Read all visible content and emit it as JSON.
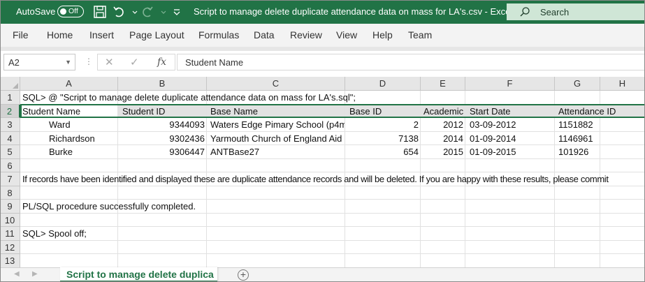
{
  "titlebar": {
    "autosave_label": "AutoSave",
    "autosave_state": "Off",
    "doc_title": "Script to manage delete duplicate attendance data on mass for LA's.csv  -  Excel",
    "search_placeholder": "Search",
    "accent_color": "#217346"
  },
  "menu": [
    "File",
    "Home",
    "Insert",
    "Page Layout",
    "Formulas",
    "Data",
    "Review",
    "View",
    "Help",
    "Team"
  ],
  "formula_bar": {
    "name_box": "A2",
    "formula": "Student Name"
  },
  "columns": [
    "A",
    "B",
    "C",
    "D",
    "E",
    "F",
    "G",
    "H"
  ],
  "rows": [
    "1",
    "2",
    "3",
    "4",
    "5",
    "6",
    "7",
    "8",
    "9",
    "10",
    "11",
    "12",
    "13"
  ],
  "cells": {
    "r1": "SQL> @ \"Script to manage delete duplicate attendance data on mass for LA's.sql\";",
    "r2": [
      "Student Name",
      "Student ID",
      "Base Name",
      "Base ID",
      "Academic",
      "Start Date",
      "Attendance ID"
    ],
    "r3": [
      "Ward",
      "9344093",
      "Waters Edge Pimary School (p4m",
      "2",
      "2012",
      "03-09-2012",
      "1151882"
    ],
    "r4": [
      "Richardson",
      "9302436",
      "Yarmouth Church of England Aid",
      "7138",
      "2014",
      "01-09-2014",
      "1146961"
    ],
    "r5": [
      "Burke",
      "9306447",
      "ANTBase27",
      "654",
      "2015",
      "01-09-2015",
      "101926"
    ],
    "r7": "If records have been identified and displayed these are duplicate attendance records and will be deleted. If you are happy with these results, please commit",
    "r9": "PL/SQL procedure successfully completed.",
    "r11": "SQL> Spool off;"
  },
  "sheet_tab": "Script to manage delete duplica"
}
